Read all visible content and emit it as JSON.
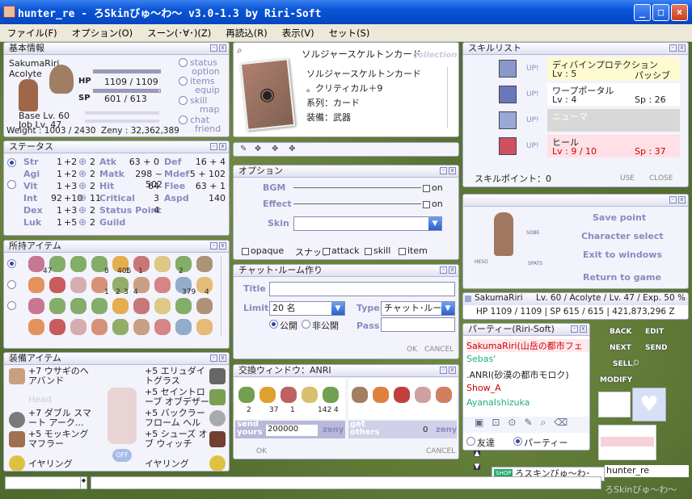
{
  "window": {
    "title": "hunter_re - ろSkinびゅ～わ～ v3.0-1.3 by Riri-Soft"
  },
  "menu": [
    "ファイル(F)",
    "オプション(O)",
    "スーン(･∀･)(Z)",
    "再読込(R)",
    "表示(V)",
    "セット(S)"
  ],
  "basic": {
    "title": "基本情報",
    "name": "SakumaRiri",
    "job": "Acolyte",
    "hp_label": "HP",
    "hp": "1109 / 1109",
    "sp_label": "SP",
    "sp": "601 / 613",
    "hp_ratio": 1.0,
    "sp_ratio": 0.98,
    "base_lv": "Base Lv. 60",
    "job_lv": "Job Lv. 47",
    "weight": "Weight : 1003 / 2430",
    "zeny": "Zeny : 32,362,389",
    "links": [
      "status",
      "option",
      "items",
      "equip",
      "skill",
      "map",
      "chat",
      "friend"
    ]
  },
  "stats": {
    "title": "ステータス",
    "rows": [
      {
        "n": "Str",
        "v": "1",
        "b": "+2",
        "p": "2"
      },
      {
        "n": "Agi",
        "v": "1",
        "b": "+2",
        "p": "2"
      },
      {
        "n": "Vit",
        "v": "1",
        "b": "+3",
        "p": "2"
      },
      {
        "n": "Int",
        "v": "92",
        "b": "+10",
        "p": "11"
      },
      {
        "n": "Dex",
        "v": "1",
        "b": "+3",
        "p": "2"
      },
      {
        "n": "Luk",
        "v": "1",
        "b": "+5",
        "p": "2"
      }
    ],
    "mid": [
      {
        "n": "Atk",
        "v": "63 + 0"
      },
      {
        "n": "Matk",
        "v": "298 ~ 502"
      },
      {
        "n": "Hit",
        "v": "64"
      },
      {
        "n": "Critical",
        "v": "3"
      },
      {
        "n": "Status Point",
        "v": "4"
      },
      {
        "n": "Guild",
        "v": ""
      }
    ],
    "right": [
      {
        "n": "Def",
        "v": "16 + 4"
      },
      {
        "n": "Mdef",
        "v": "5 + 102"
      },
      {
        "n": "Flee",
        "v": "63 + 1"
      },
      {
        "n": "Aspd",
        "v": "140"
      }
    ]
  },
  "inventory": {
    "title": "所持アイテム",
    "counts": [
      "47",
      "8",
      "406",
      "1",
      "1",
      "2",
      "1",
      "2",
      "3",
      "4",
      "379",
      "4"
    ]
  },
  "equip": {
    "title": "装備アイテム",
    "left": [
      "+7 ウサギのヘアバンド",
      "Head",
      "+7 ダブル スマート アーク...",
      "+5 モッキング マフラー",
      "イヤリング"
    ],
    "right": [
      "+5 エリュダイトグラス",
      "+5 セイントローブ オブデザー",
      "+5 バックラー フローム ヘル",
      "+5 シューズ オブ ウィッチ",
      "イヤリング"
    ],
    "off": "OFF"
  },
  "card": {
    "title": "ソルジャースケルトンカード",
    "watermark": "collection",
    "lines": [
      "ソルジャースケルトンカード",
      "。クリティカル＋9",
      "系列：カード",
      "装備：武器"
    ]
  },
  "option": {
    "title": "オプション",
    "bgm": "BGM",
    "effect": "Effect",
    "on": "on",
    "skin": "Skin",
    "opaque": "opaque",
    "snap": "スナップ",
    "attack": "attack",
    "skill": "skill",
    "item": "item"
  },
  "chat": {
    "title": "チャット･ルーム作り",
    "title_label": "Title",
    "limit_label": "Limit",
    "limit": "20 名",
    "type_label": "Type",
    "type": "チャット･ルー",
    "public": "公開",
    "private": "非公開",
    "pass": "Pass",
    "ok": "OK",
    "cancel": "CANCEL"
  },
  "trade": {
    "title": "交換ウィンドウ：ANRI",
    "send_label": "send yours",
    "send_amt": "200000",
    "zeny": "zeny",
    "get_label": "get others",
    "get_amt": "0",
    "ok": "OK",
    "cancel": "CANCEL",
    "counts": [
      "2",
      "37",
      "1",
      "142",
      "4"
    ]
  },
  "skills": {
    "title": "スキルリスト",
    "up": "UP!",
    "rows": [
      {
        "name": "ディバインプロテクション",
        "lv": "Lv : 5",
        "extra": "パッシブ",
        "color": "#fffbd0"
      },
      {
        "name": "ワープポータル",
        "lv": "Lv : 4",
        "extra": "Sp : 26",
        "color": "#ffffff"
      },
      {
        "name": "ニューマ",
        "lv": "",
        "extra": "",
        "color": "#d8d8d8"
      },
      {
        "name": "ヒール",
        "lv": "Lv :   9  / 10",
        "extra": "Sp : 37",
        "color": "#ffe0e6"
      }
    ],
    "points": "スキルポイント：0",
    "use": "USE",
    "close": "CLOSE"
  },
  "menu_panel": {
    "items": [
      "Save point",
      "Character select",
      "Exit to windows",
      "Return to game"
    ],
    "labels": [
      "SOBE",
      "HESO",
      "SPATS"
    ]
  },
  "status_bar": {
    "name": "SakumaRiri",
    "lv": "Lv. 60 / Acolyte / Lv. 47 / Exp. 50 %",
    "hp": "HP 1109 / 1109 | SP 615 / 615 | 421,873,296 Z"
  },
  "party": {
    "title": "パーティー(Riri-Soft)",
    "members": [
      {
        "n": "SakumaRiri(山岳の都市フェ",
        "c": "#c00"
      },
      {
        "n": "Sebas'",
        "c": "#2a8"
      },
      {
        "n": ".ANRI(砂漠の都市モロク)",
        "c": "#222"
      },
      {
        "n": "Show_A",
        "c": "#c00"
      },
      {
        "n": "AyanaIshizuka",
        "c": "#2a8"
      }
    ],
    "friend": "友達",
    "party": "パーティー"
  },
  "mini": [
    "BACK",
    "EDIT",
    "NEXT",
    "SEND",
    "SELL",
    "MODIFY"
  ],
  "shop": {
    "tag": "SHOP",
    "name": "ろスキンびゅ～わ･"
  },
  "bottom": {
    "name": "hunter_re",
    "logo": "ろSkinびゅ～わ～"
  }
}
